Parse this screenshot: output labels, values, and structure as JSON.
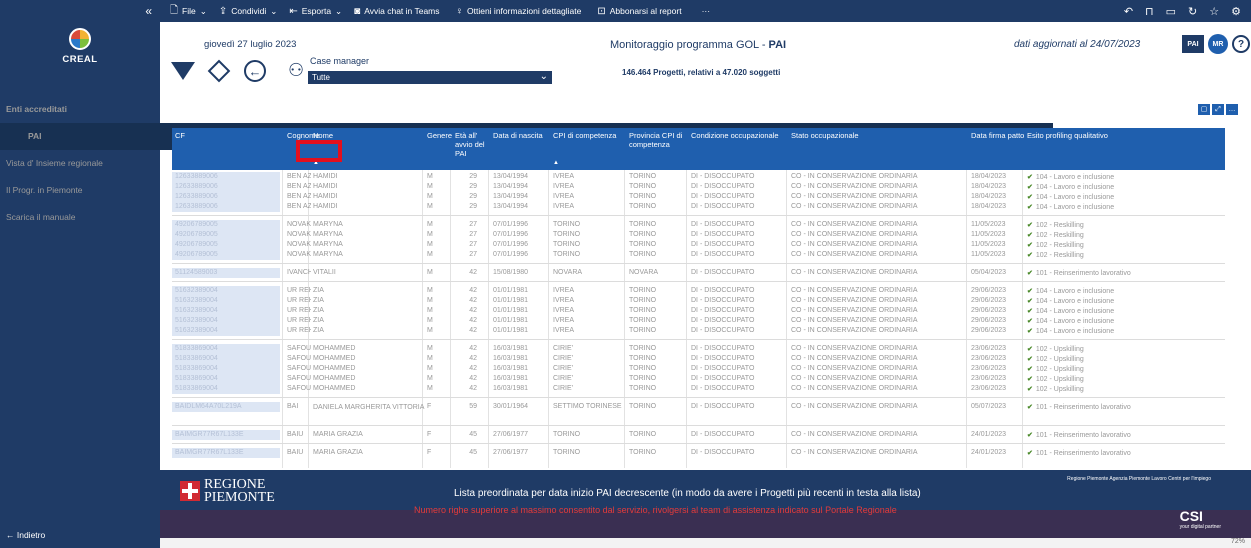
{
  "topbar": {
    "items": [
      {
        "icon": "document-icon",
        "glyph": "🗋",
        "label": "File",
        "chev": "⌄"
      },
      {
        "icon": "share-icon",
        "glyph": "⇪",
        "label": "Condividi",
        "chev": "⌄"
      },
      {
        "icon": "export-icon",
        "glyph": "⇤",
        "label": "Esporta",
        "chev": "⌄"
      },
      {
        "icon": "teams-icon",
        "glyph": "◙",
        "label": "Avvia chat in Teams",
        "chev": ""
      },
      {
        "icon": "insight-icon",
        "glyph": "♀",
        "label": "Ottieni informazioni dettagliate",
        "chev": ""
      },
      {
        "icon": "subscribe-icon",
        "glyph": "⊡",
        "label": "Abbonarsi al report",
        "chev": ""
      },
      {
        "icon": "more-icon",
        "glyph": "",
        "label": "···",
        "chev": ""
      }
    ]
  },
  "sidebar": {
    "logo_text": "CREAL",
    "items": [
      {
        "label": "Enti accreditati",
        "bold": true,
        "chev": "^"
      },
      {
        "label": "PAI",
        "active": true
      },
      {
        "label": "Vista d' Insieme regionale",
        "chev": "⌄"
      },
      {
        "label": "Il Progr. in Piemonte"
      },
      {
        "label": "Scarica il manuale"
      }
    ],
    "back_label": "←   Indietro"
  },
  "header": {
    "date": "giovedì 27 luglio 2023",
    "case_manager_label": "Case manager",
    "case_manager_value": "Tutte",
    "title": "Monitoraggio programma GOL - ",
    "title_bold": "PAI",
    "subtitle": "146.464 Progetti, relativi a 47.020 soggetti",
    "updated": "dati aggiornati al 24/07/2023",
    "avatar": "MR",
    "pai_badge": "PAI"
  },
  "table": {
    "headers": [
      "CF",
      "Cognome",
      "Nome",
      "Genere",
      "Età all' avvio del PAI",
      "Data di nascita",
      "CPI di competenza",
      "Provincia CPI di competenza",
      "Condizione occupazionale",
      "Stato occupazionale",
      "Data firma patto",
      "Esito profiling qualitativo"
    ],
    "rows": [
      {
        "cf": "12633889006",
        "cognome": "BEN AZIZA",
        "nome": "HAMIDI",
        "genere": "M",
        "eta": "29",
        "nascita": "13/04/1994",
        "cpi": "IVREA",
        "prov": "TORINO",
        "cond": "DI - DISOCCUPATO",
        "stato": "CO - IN CONSERVAZIONE ORDINARIA",
        "firma": "18/04/2023",
        "esito": "104 - Lavoro e inclusione"
      },
      {
        "cf": "12633889006",
        "cognome": "BEN AZIZA",
        "nome": "HAMIDI",
        "genere": "M",
        "eta": "29",
        "nascita": "13/04/1994",
        "cpi": "IVREA",
        "prov": "TORINO",
        "cond": "DI - DISOCCUPATO",
        "stato": "CO - IN CONSERVAZIONE ORDINARIA",
        "firma": "18/04/2023",
        "esito": "104 - Lavoro e inclusione"
      },
      {
        "cf": "12633889006",
        "cognome": "BEN AZIZA",
        "nome": "HAMIDI",
        "genere": "M",
        "eta": "29",
        "nascita": "13/04/1994",
        "cpi": "IVREA",
        "prov": "TORINO",
        "cond": "DI - DISOCCUPATO",
        "stato": "CO - IN CONSERVAZIONE ORDINARIA",
        "firma": "18/04/2023",
        "esito": "104 - Lavoro e inclusione"
      },
      {
        "cf": "12633889006",
        "cognome": "BEN AZIZA",
        "nome": "HAMIDI",
        "genere": "M",
        "eta": "29",
        "nascita": "13/04/1994",
        "cpi": "IVREA",
        "prov": "TORINO",
        "cond": "DI - DISOCCUPATO",
        "stato": "CO - IN CONSERVAZIONE ORDINARIA",
        "firma": "18/04/2023",
        "esito": "104 - Lavoro e inclusione"
      },
      {
        "sep": true
      },
      {
        "cf": "49206789005",
        "cognome": "NOVAK",
        "nome": "MARYNA",
        "genere": "M",
        "eta": "27",
        "nascita": "07/01/1996",
        "cpi": "TORINO",
        "prov": "TORINO",
        "cond": "DI - DISOCCUPATO",
        "stato": "CO - IN CONSERVAZIONE ORDINARIA",
        "firma": "11/05/2023",
        "esito": "102 - Reskilling"
      },
      {
        "cf": "49206789005",
        "cognome": "NOVAK",
        "nome": "MARYNA",
        "genere": "M",
        "eta": "27",
        "nascita": "07/01/1996",
        "cpi": "TORINO",
        "prov": "TORINO",
        "cond": "DI - DISOCCUPATO",
        "stato": "CO - IN CONSERVAZIONE ORDINARIA",
        "firma": "11/05/2023",
        "esito": "102 - Reskilling"
      },
      {
        "cf": "49206789005",
        "cognome": "NOVAK",
        "nome": "MARYNA",
        "genere": "M",
        "eta": "27",
        "nascita": "07/01/1996",
        "cpi": "TORINO",
        "prov": "TORINO",
        "cond": "DI - DISOCCUPATO",
        "stato": "CO - IN CONSERVAZIONE ORDINARIA",
        "firma": "11/05/2023",
        "esito": "102 - Reskilling"
      },
      {
        "cf": "49206789005",
        "cognome": "NOVAK",
        "nome": "MARYNA",
        "genere": "M",
        "eta": "27",
        "nascita": "07/01/1996",
        "cpi": "TORINO",
        "prov": "TORINO",
        "cond": "DI - DISOCCUPATO",
        "stato": "CO - IN CONSERVAZIONE ORDINARIA",
        "firma": "11/05/2023",
        "esito": "102 - Reskilling"
      },
      {
        "sep": true
      },
      {
        "cf": "51124589003",
        "cognome": "IVANCHUK",
        "nome": "VITALII",
        "genere": "M",
        "eta": "42",
        "nascita": "15/08/1980",
        "cpi": "NOVARA",
        "prov": "NOVARA",
        "cond": "DI - DISOCCUPATO",
        "stato": "CO - IN CONSERVAZIONE ORDINARIA",
        "firma": "05/04/2023",
        "esito": "101 - Reinserimento lavorativo"
      },
      {
        "sep": true
      },
      {
        "cf": "51632389004",
        "cognome": "UR REHMAN",
        "nome": "ZIA",
        "genere": "M",
        "eta": "42",
        "nascita": "01/01/1981",
        "cpi": "IVREA",
        "prov": "TORINO",
        "cond": "DI - DISOCCUPATO",
        "stato": "CO - IN CONSERVAZIONE ORDINARIA",
        "firma": "29/06/2023",
        "esito": "104 - Lavoro e inclusione"
      },
      {
        "cf": "51632389004",
        "cognome": "UR REHMAN",
        "nome": "ZIA",
        "genere": "M",
        "eta": "42",
        "nascita": "01/01/1981",
        "cpi": "IVREA",
        "prov": "TORINO",
        "cond": "DI - DISOCCUPATO",
        "stato": "CO - IN CONSERVAZIONE ORDINARIA",
        "firma": "29/06/2023",
        "esito": "104 - Lavoro e inclusione"
      },
      {
        "cf": "51632389004",
        "cognome": "UR REHMAN",
        "nome": "ZIA",
        "genere": "M",
        "eta": "42",
        "nascita": "01/01/1981",
        "cpi": "IVREA",
        "prov": "TORINO",
        "cond": "DI - DISOCCUPATO",
        "stato": "CO - IN CONSERVAZIONE ORDINARIA",
        "firma": "29/06/2023",
        "esito": "104 - Lavoro e inclusione"
      },
      {
        "cf": "51632389004",
        "cognome": "UR REHMAN",
        "nome": "ZIA",
        "genere": "M",
        "eta": "42",
        "nascita": "01/01/1981",
        "cpi": "IVREA",
        "prov": "TORINO",
        "cond": "DI - DISOCCUPATO",
        "stato": "CO - IN CONSERVAZIONE ORDINARIA",
        "firma": "29/06/2023",
        "esito": "104 - Lavoro e inclusione"
      },
      {
        "cf": "51632389004",
        "cognome": "UR REHMAN",
        "nome": "ZIA",
        "genere": "M",
        "eta": "42",
        "nascita": "01/01/1981",
        "cpi": "IVREA",
        "prov": "TORINO",
        "cond": "DI - DISOCCUPATO",
        "stato": "CO - IN CONSERVAZIONE ORDINARIA",
        "firma": "29/06/2023",
        "esito": "104 - Lavoro e inclusione"
      },
      {
        "sep": true
      },
      {
        "cf": "51833869004",
        "cognome": "SAFOUH",
        "nome": "MOHAMMED",
        "genere": "M",
        "eta": "42",
        "nascita": "16/03/1981",
        "cpi": "CIRIE'",
        "prov": "TORINO",
        "cond": "DI - DISOCCUPATO",
        "stato": "CO - IN CONSERVAZIONE ORDINARIA",
        "firma": "23/06/2023",
        "esito": "102 - Upskilling"
      },
      {
        "cf": "51833869004",
        "cognome": "SAFOUH",
        "nome": "MOHAMMED",
        "genere": "M",
        "eta": "42",
        "nascita": "16/03/1981",
        "cpi": "CIRIE'",
        "prov": "TORINO",
        "cond": "DI - DISOCCUPATO",
        "stato": "CO - IN CONSERVAZIONE ORDINARIA",
        "firma": "23/06/2023",
        "esito": "102 - Upskilling"
      },
      {
        "cf": "51833869004",
        "cognome": "SAFOUH",
        "nome": "MOHAMMED",
        "genere": "M",
        "eta": "42",
        "nascita": "16/03/1981",
        "cpi": "CIRIE'",
        "prov": "TORINO",
        "cond": "DI - DISOCCUPATO",
        "stato": "CO - IN CONSERVAZIONE ORDINARIA",
        "firma": "23/06/2023",
        "esito": "102 - Upskilling"
      },
      {
        "cf": "51833869004",
        "cognome": "SAFOUH",
        "nome": "MOHAMMED",
        "genere": "M",
        "eta": "42",
        "nascita": "16/03/1981",
        "cpi": "CIRIE'",
        "prov": "TORINO",
        "cond": "DI - DISOCCUPATO",
        "stato": "CO - IN CONSERVAZIONE ORDINARIA",
        "firma": "23/06/2023",
        "esito": "102 - Upskilling"
      },
      {
        "cf": "51833869004",
        "cognome": "SAFOUH",
        "nome": "MOHAMMED",
        "genere": "M",
        "eta": "42",
        "nascita": "16/03/1981",
        "cpi": "CIRIE'",
        "prov": "TORINO",
        "cond": "DI - DISOCCUPATO",
        "stato": "CO - IN CONSERVAZIONE ORDINARIA",
        "firma": "23/06/2023",
        "esito": "102 - Upskilling"
      },
      {
        "sep": true
      },
      {
        "cf": "BAIDLM64A70L219A",
        "cognome": "BAI",
        "nome": "DANIELA MARGHERITA VITTORIA",
        "genere": "F",
        "eta": "59",
        "nascita": "30/01/1964",
        "cpi": "SETTIMO TORINESE",
        "prov": "TORINO",
        "cond": "DI - DISOCCUPATO",
        "stato": "CO - IN CONSERVAZIONE ORDINARIA",
        "firma": "05/07/2023",
        "esito": "101 - Reinserimento lavorativo",
        "tall": true
      },
      {
        "sep": true
      },
      {
        "cf": "BAIMGR77R67L133E",
        "cognome": "BAIU",
        "nome": "MARIA GRAZIA",
        "genere": "F",
        "eta": "45",
        "nascita": "27/06/1977",
        "cpi": "TORINO",
        "prov": "TORINO",
        "cond": "DI - DISOCCUPATO",
        "stato": "CO - IN CONSERVAZIONE ORDINARIA",
        "firma": "24/01/2023",
        "esito": "101 - Reinserimento lavorativo"
      },
      {
        "sep": true
      },
      {
        "cf": "BAIMGR77R67L133E",
        "cognome": "BAIU",
        "nome": "MARIA GRAZIA",
        "genere": "F",
        "eta": "45",
        "nascita": "27/06/1977",
        "cpi": "TORINO",
        "prov": "TORINO",
        "cond": "DI - DISOCCUPATO",
        "stato": "CO - IN CONSERVAZIONE ORDINARIA",
        "firma": "24/01/2023",
        "esito": "101 - Reinserimento lavorativo"
      }
    ]
  },
  "footer": {
    "region_line1": "REGIONE",
    "region_line2": "PIEMONTE",
    "message": "Lista preordinata per data inizio PAI decrescente (in modo da avere i Progetti più recenti in testa alla lista)",
    "warning": "Numero righe superiore al massimo consentito dal servizio, rivolgersi al team di assistenza indicato sul Portale Regionale",
    "partner_text": "Regione Piemonte Agenzia Piemonte Lavoro Centri per l'impiego",
    "csi": "CSI",
    "csi_sub": "your digital partner"
  },
  "status": {
    "zoom": "72%"
  },
  "colors": {
    "navy": "#1f3b66",
    "header_blue": "#1f5fae",
    "highlight": "#e3101e"
  }
}
